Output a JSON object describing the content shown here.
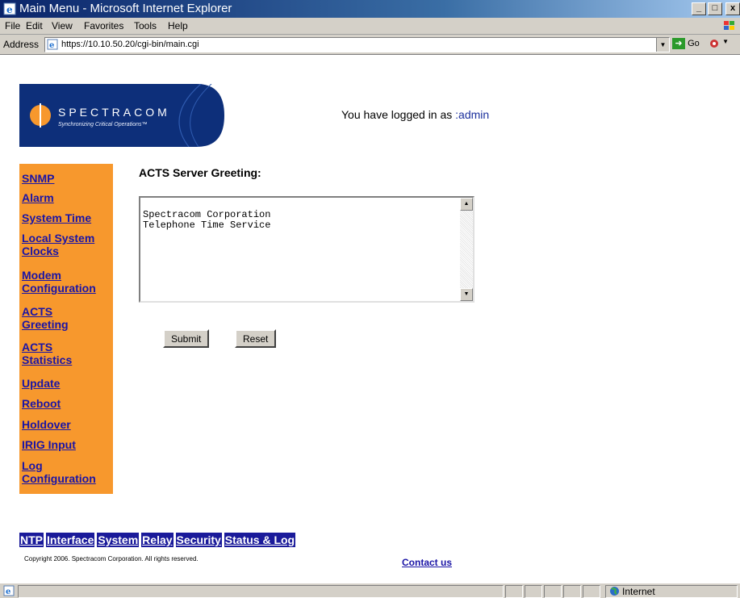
{
  "window": {
    "title": "Main Menu - Microsoft Internet Explorer",
    "controls": {
      "minimize": "_",
      "maximize": "□",
      "close": "x"
    }
  },
  "menubar": {
    "items": [
      "File",
      "Edit",
      "View",
      "Favorites",
      "Tools",
      "Help"
    ]
  },
  "addressbar": {
    "label": "Address",
    "url": "https://10.10.50.20/cgi-bin/main.cgi",
    "go_label": "Go"
  },
  "header": {
    "logo_name": "SPECTRACOM",
    "logo_tagline": "Synchronizing Critical Operations™",
    "logged_in_prefix": "You have logged in as ",
    "logged_in_user": ":admin"
  },
  "sidebar": {
    "items": [
      {
        "label": "SNMP"
      },
      {
        "label": "Alarm"
      },
      {
        "label": "System Time"
      },
      {
        "label": "Local System\nClocks"
      },
      {
        "label": "Modem\nConfiguration"
      },
      {
        "label": "ACTS\nGreeting"
      },
      {
        "label": "ACTS\nStatistics"
      },
      {
        "label": "Update"
      },
      {
        "label": "Reboot"
      },
      {
        "label": "Holdover"
      },
      {
        "label": "IRIG Input"
      },
      {
        "label": "Log\nConfiguration"
      }
    ]
  },
  "main": {
    "heading": "ACTS Server Greeting:",
    "greeting_text": "Spectracom Corporation\nTelephone Time Service",
    "submit_label": "Submit",
    "reset_label": "Reset"
  },
  "footer": {
    "nav": [
      "NTP",
      "Interface",
      "System",
      "Relay",
      "Security",
      "Status & Log"
    ],
    "copyright": "Copyright 2006. Spectracom Corporation. All rights reserved.",
    "contact": "Contact us"
  },
  "statusbar": {
    "zone": "Internet"
  },
  "colors": {
    "sidebar_bg": "#f7982d",
    "link": "#1a14a6",
    "footer_nav_bg": "#1a1a9a",
    "logo_blue": "#0d2f7a"
  },
  "icons": [
    "ie-page-icon",
    "go-arrow-icon",
    "windows-flag-icon",
    "internet-globe-icon",
    "spectracom-logo"
  ]
}
